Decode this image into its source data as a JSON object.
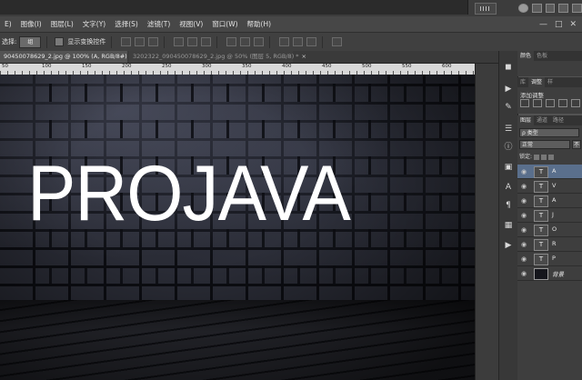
{
  "menu": [
    "图像(I)",
    "图层(L)",
    "文字(Y)",
    "选择(S)",
    "滤镜(T)",
    "视图(V)",
    "窗口(W)",
    "帮助(H)"
  ],
  "menu_partial_left": "E)",
  "window_controls": [
    "—",
    "□",
    "✕"
  ],
  "options": {
    "tool_label": "选择:",
    "select_value": "组",
    "show_transform_label": "显示变换控件"
  },
  "tabs": {
    "active": "90450078629_2.jpg @ 100% (A, RGB/8#) *",
    "inactive": "3202322_090450078629_2.jpg @ 50% (图层 5, RGB/8) *"
  },
  "ruler_numbers": [
    "50",
    "100",
    "150",
    "200",
    "250",
    "300",
    "350",
    "400",
    "450",
    "500",
    "550",
    "600"
  ],
  "canvas": {
    "headline": "PROJAVA"
  },
  "panels": {
    "top_tabs": [
      "颜色",
      "色板"
    ],
    "adj_tabs": [
      "库",
      "调整",
      "样"
    ],
    "adj_title": "添加调整",
    "layers_tabs": [
      "图层",
      "通道",
      "路径"
    ],
    "kind_label": "ρ 类型",
    "blend_mode": "正常",
    "opacity_label": "不",
    "lock_label": "锁定:",
    "layers": [
      {
        "name": "A",
        "type": "text",
        "selected": true
      },
      {
        "name": "V",
        "type": "text",
        "selected": false
      },
      {
        "name": "A",
        "type": "text",
        "selected": false
      },
      {
        "name": "J",
        "type": "text",
        "selected": false
      },
      {
        "name": "O",
        "type": "text",
        "selected": false
      },
      {
        "name": "R",
        "type": "text",
        "selected": false
      },
      {
        "name": "P",
        "type": "text",
        "selected": false
      },
      {
        "name": "背景",
        "type": "image",
        "selected": false
      }
    ]
  },
  "colors": {
    "selection": "#5a6f8c",
    "panel_bg": "#3e3e3e",
    "app_bg": "#535353"
  }
}
